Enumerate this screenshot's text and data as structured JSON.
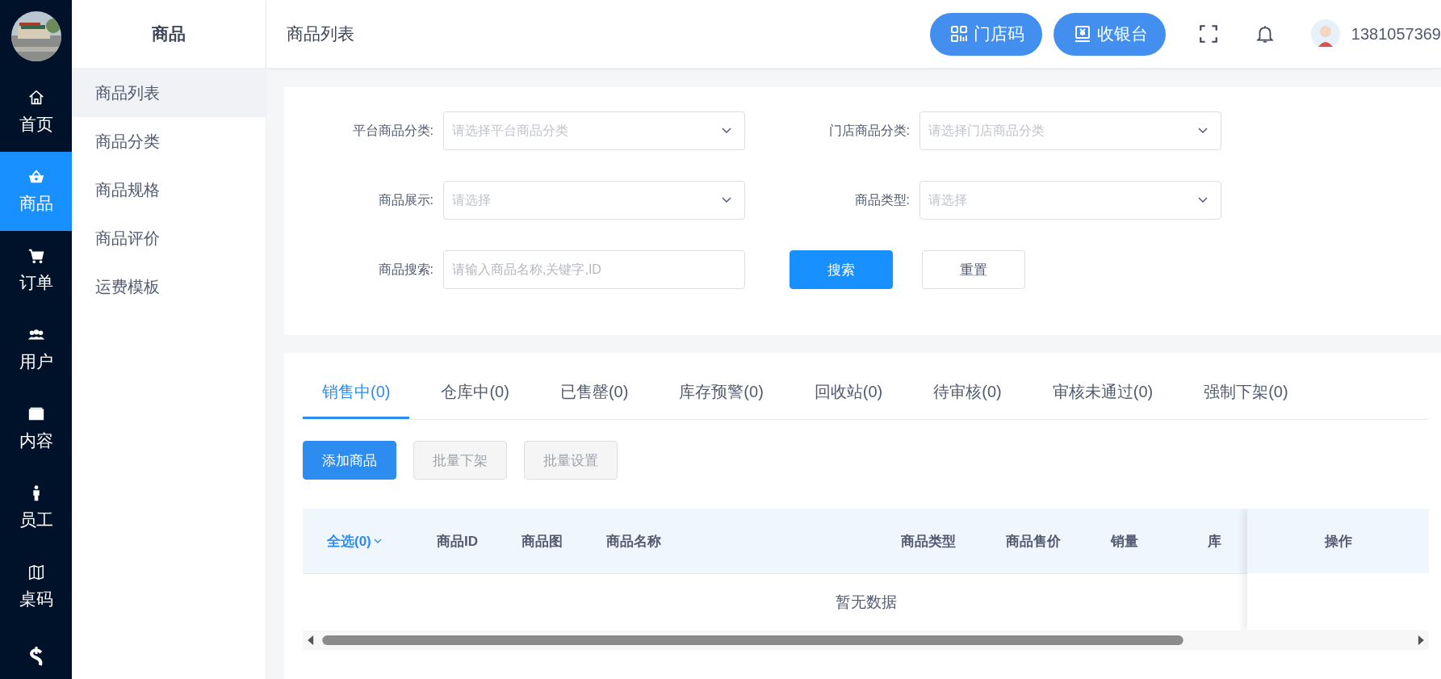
{
  "rail": {
    "items": [
      {
        "label": "首页",
        "selected": false
      },
      {
        "label": "商品",
        "selected": true
      },
      {
        "label": "订单",
        "selected": false
      },
      {
        "label": "用户",
        "selected": false
      },
      {
        "label": "内容",
        "selected": false
      },
      {
        "label": "员工",
        "selected": false
      },
      {
        "label": "桌码",
        "selected": false
      }
    ]
  },
  "submenu": {
    "title": "商品",
    "items": [
      {
        "label": "商品列表",
        "selected": true
      },
      {
        "label": "商品分类",
        "selected": false
      },
      {
        "label": "商品规格",
        "selected": false
      },
      {
        "label": "商品评价",
        "selected": false
      },
      {
        "label": "运费模板",
        "selected": false
      }
    ]
  },
  "header": {
    "title": "商品列表",
    "buttons": [
      {
        "label": "门店码"
      },
      {
        "label": "收银台"
      }
    ],
    "user": "1381057369"
  },
  "filter_rows": [
    [
      {
        "label": "平台商品分类:",
        "kind": "select",
        "placeholder": "请选择平台商品分类"
      },
      {
        "label": "门店商品分类:",
        "kind": "select",
        "placeholder": "请选择门店商品分类"
      }
    ],
    [
      {
        "label": "商品展示:",
        "kind": "select",
        "placeholder": "请选择"
      },
      {
        "label": "商品类型:",
        "kind": "select",
        "placeholder": "请选择"
      }
    ],
    [
      {
        "label": "商品搜索:",
        "kind": "input",
        "placeholder": "请输入商品名称,关键字,ID"
      }
    ]
  ],
  "filter_buttons": [
    {
      "label": "搜索",
      "kind": "primary"
    },
    {
      "label": "重置",
      "kind": "default"
    }
  ],
  "tabs": [
    {
      "label": "销售中(0)",
      "selected": true
    },
    {
      "label": "仓库中(0)",
      "selected": false
    },
    {
      "label": "已售罄(0)",
      "selected": false
    },
    {
      "label": "库存预警(0)",
      "selected": false
    },
    {
      "label": "回收站(0)",
      "selected": false
    },
    {
      "label": "待审核(0)",
      "selected": false
    },
    {
      "label": "审核未通过(0)",
      "selected": false
    },
    {
      "label": "强制下架(0)",
      "selected": false
    }
  ],
  "actions": [
    {
      "label": "添加商品",
      "disabled": false
    },
    {
      "label": "批量下架",
      "disabled": true
    },
    {
      "label": "批量设置",
      "disabled": true
    }
  ],
  "table": {
    "select_all": "全选(0)",
    "columns": [
      "商品ID",
      "商品图",
      "商品名称",
      "商品类型",
      "商品售价",
      "销量",
      "库"
    ],
    "fixed_column": "操作",
    "empty_text": "暂无数据"
  }
}
